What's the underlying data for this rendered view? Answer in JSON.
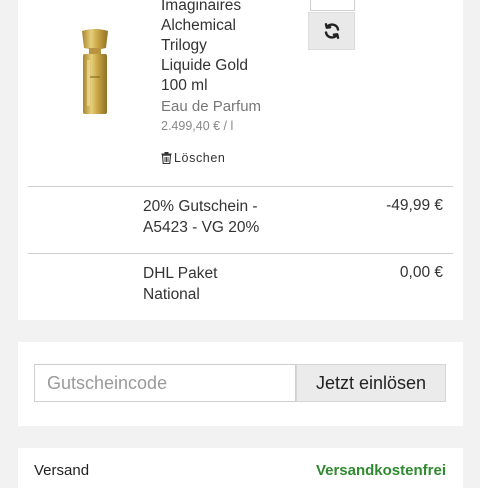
{
  "product": {
    "name_lines": [
      "Imaginaires",
      "Alchemical",
      "Trilogy",
      "Liquide Gold",
      "100 ml"
    ],
    "type": "Eau de Parfum",
    "unit_price": "2.499,40 € / l",
    "delete_label": "Löschen",
    "image_icon": "perfume-bottle-icon",
    "refresh_icon": "refresh-icon",
    "delete_icon": "trash-icon"
  },
  "discount": {
    "lines": [
      "20% Gutschein -",
      "A5423 - VG 20%"
    ],
    "amount": "-49,99 €"
  },
  "shipping_row": {
    "lines": [
      "DHL Paket",
      "National"
    ],
    "amount": "0,00 €"
  },
  "coupon": {
    "placeholder": "Gutscheincode",
    "button_label": "Jetzt einlösen"
  },
  "summary": {
    "shipping_label": "Versand",
    "shipping_value": "Versandkostenfrei"
  },
  "colors": {
    "free_shipping": "#2f8a2f",
    "bottle_gold": "#c9a646"
  }
}
